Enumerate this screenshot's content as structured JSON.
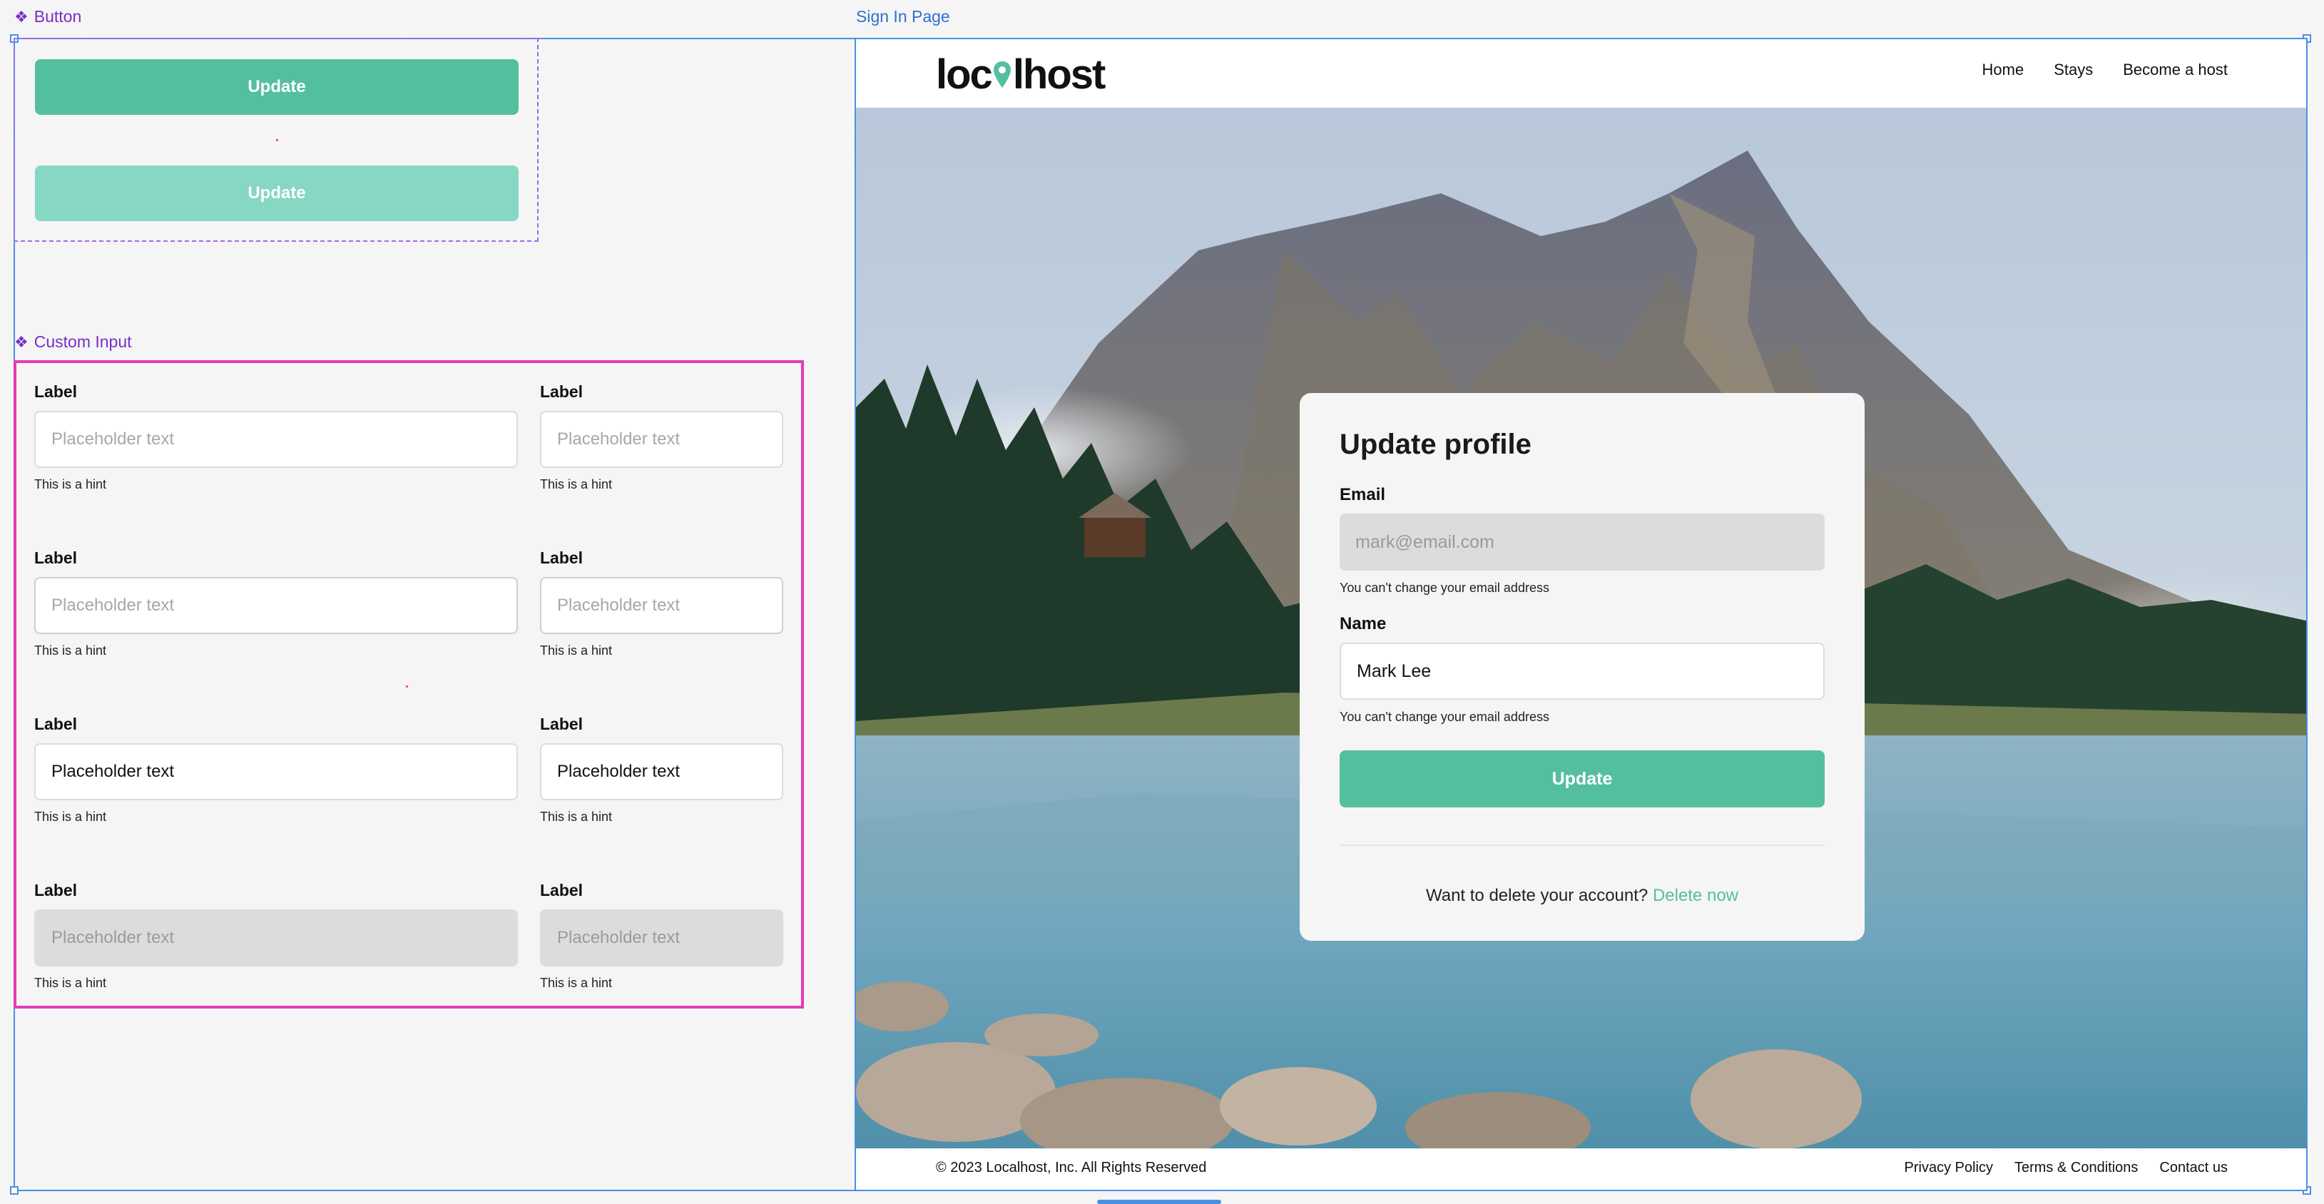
{
  "canvas": {
    "button_component_label": "Button",
    "input_component_label": "Custom Input",
    "page_frame_label": "Sign In Page"
  },
  "button_variants": [
    {
      "label": "Update",
      "state": "default",
      "color": "#54bf9f"
    },
    {
      "label": "Update",
      "state": "disabled",
      "color": "#86d7c3"
    }
  ],
  "custom_inputs": [
    {
      "label": "Label",
      "placeholder": "Placeholder text",
      "value": "",
      "hint": "This is a hint",
      "state": "default"
    },
    {
      "label": "Label",
      "placeholder": "Placeholder text",
      "value": "",
      "hint": "This is a hint",
      "state": "default"
    },
    {
      "label": "Label",
      "placeholder": "Placeholder text",
      "value": "",
      "hint": "This is a hint",
      "state": "hover"
    },
    {
      "label": "Label",
      "placeholder": "Placeholder text",
      "value": "",
      "hint": "This is a hint",
      "state": "hover"
    },
    {
      "label": "Label",
      "placeholder": "Placeholder text",
      "value": "Placeholder text",
      "hint": "This is a hint",
      "state": "filled"
    },
    {
      "label": "Label",
      "placeholder": "Placeholder text",
      "value": "Placeholder text",
      "hint": "This is a hint",
      "state": "filled"
    },
    {
      "label": "Label",
      "placeholder": "Placeholder text",
      "value": "",
      "hint": "This is a hint",
      "state": "disabled"
    },
    {
      "label": "Label",
      "placeholder": "Placeholder text",
      "value": "",
      "hint": "This is a hint",
      "state": "disabled"
    }
  ],
  "site": {
    "logo": {
      "before": "loc",
      "after": "lhost",
      "icon": "map-pin-icon"
    },
    "nav": [
      "Home",
      "Stays",
      "Become a host"
    ],
    "footer": {
      "copyright": "© 2023 Localhost, Inc. All Rights Reserved",
      "links": [
        "Privacy Policy",
        "Terms & Conditions",
        "Contact us"
      ]
    }
  },
  "profile_card": {
    "title": "Update profile",
    "email": {
      "label": "Email",
      "placeholder": "mark@email.com",
      "hint": "You can't change your email address"
    },
    "name": {
      "label": "Name",
      "value": "Mark Lee",
      "hint": "You can't change your email address"
    },
    "submit_label": "Update",
    "delete_prompt": "Want to delete your account?",
    "delete_link": "Delete now"
  },
  "colors": {
    "accent": "#54bf9f",
    "accent_light": "#86d7c3",
    "component_purple": "#7a2fc6",
    "input_frame_pink": "#e43bb8",
    "selection_blue": "#4a90e2"
  }
}
